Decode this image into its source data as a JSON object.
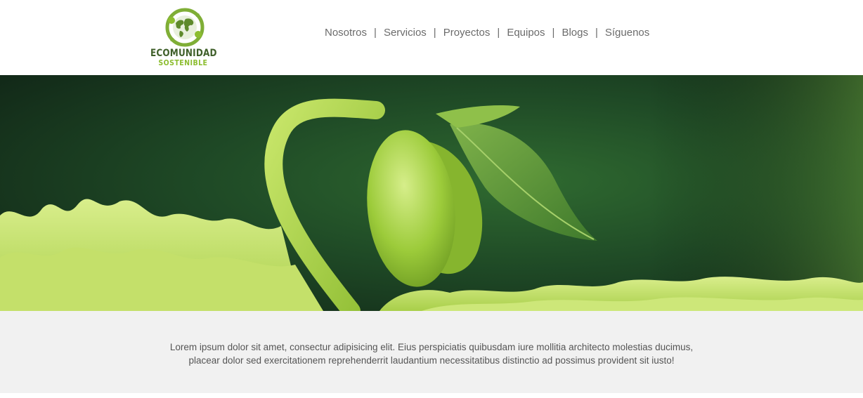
{
  "header": {
    "logo": {
      "line1": "ECOMUNIDAD",
      "line2": "SOSTENIBLE",
      "icon": "globe-recycle-icon"
    },
    "nav": [
      {
        "label": "Nosotros"
      },
      {
        "label": "Servicios"
      },
      {
        "label": "Proyectos"
      },
      {
        "label": "Equipos"
      },
      {
        "label": "Blogs"
      },
      {
        "label": "Síguenos"
      }
    ],
    "separator": "|"
  },
  "hero": {
    "image": "sprouting-bean-seedling-photo"
  },
  "intro": {
    "line1": "Lorem ipsum dolor sit amet, consectur adipisicing elit. Eius perspiciatis quibusdam iure mollitia architecto molestias ducimus,",
    "line2": "placear dolor sed exercitationem reprehenderrit laudantium necessitatibus distinctio ad possimus provident sit iusto!"
  },
  "colors": {
    "brand_dark": "#3f5f2a",
    "brand_light": "#8cbd2f",
    "nav_text": "#6b6b6b",
    "band_bg": "#f1f1f1"
  }
}
